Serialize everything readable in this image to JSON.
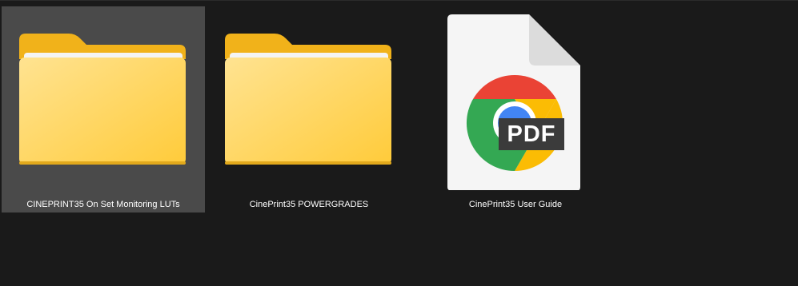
{
  "explorer": {
    "items": [
      {
        "type": "folder",
        "label": "CINEPRINT35 On Set Monitoring LUTs",
        "selected": true,
        "icon": "folder-icon"
      },
      {
        "type": "folder",
        "label": "CinePrint35 POWERGRADES",
        "selected": false,
        "icon": "folder-icon"
      },
      {
        "type": "pdf",
        "label": "CinePrint35 User Guide",
        "selected": false,
        "icon": "chrome-pdf-icon",
        "badge": "PDF"
      }
    ]
  }
}
